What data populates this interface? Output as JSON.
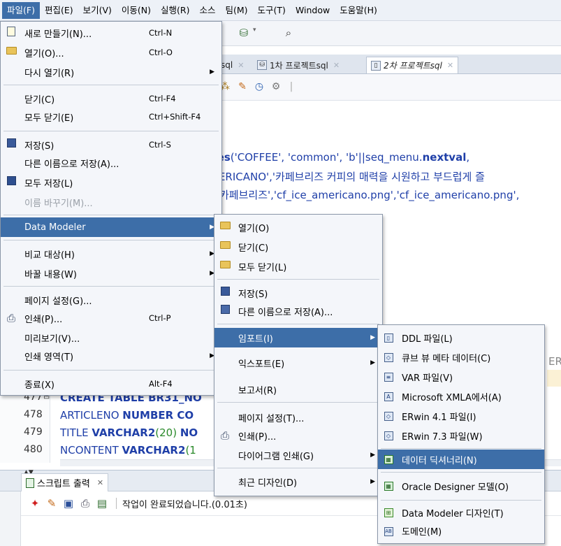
{
  "menubar": {
    "items": [
      "파일(F)",
      "편집(E)",
      "보기(V)",
      "이동(N)",
      "실행(R)",
      "소스",
      "팀(M)",
      "도구(T)",
      "Window",
      "도움말(H)"
    ]
  },
  "editor_tabs": [
    {
      "label": "sql"
    },
    {
      "label": "1차 프로젝트sql"
    },
    {
      "label": "2차 프로젝트sql"
    }
  ],
  "editor": {
    "code_top": [
      {
        "parts": [
          "ues",
          "('COFFEE', 'common', 'b'||seq_menu.",
          "nextval",
          ","
        ]
      },
      {
        "parts": [
          "MERICANO','카페브리즈 커피의 매력을 시원하고 부드럽게 즐"
        ]
      },
      {
        "parts": [
          "카페브리즈','cf_ice_americano.png','cf_ice_americano.png',"
        ]
      }
    ],
    "line_numbers": [
      "477",
      "478",
      "479",
      "480"
    ],
    "code_lines": [
      {
        "parts": [
          "CREATE TABLE ",
          "BR31_NO"
        ]
      },
      {
        "parts": [
          "ARTICLENO ",
          "NUMBER CO"
        ]
      },
      {
        "parts": [
          "TITLE ",
          "VARCHAR2",
          "(20) ",
          "NO"
        ]
      },
      {
        "parts": [
          "NCONTENT ",
          "VARCHAR2",
          "(1"
        ]
      }
    ],
    "right_clip": "ER",
    "collapse_marker": "⊟"
  },
  "output_panel": {
    "tab_label": "스크립트 출력",
    "status": "작업이 완료되었습니다.(0.01초)"
  },
  "file_menu": [
    {
      "type": "item",
      "label": "새로 만들기(N)...",
      "shortcut": "Ctrl-N",
      "icon": "new-icon"
    },
    {
      "type": "item",
      "label": "열기(O)...",
      "shortcut": "Ctrl-O",
      "icon": "folder-icon"
    },
    {
      "type": "item",
      "label": "다시 열기(R)",
      "shortcut": "",
      "submenu": true
    },
    {
      "type": "sep"
    },
    {
      "type": "item",
      "label": "닫기(C)",
      "shortcut": "Ctrl-F4"
    },
    {
      "type": "item",
      "label": "모두 닫기(E)",
      "shortcut": "Ctrl+Shift-F4"
    },
    {
      "type": "sep"
    },
    {
      "type": "item",
      "label": "저장(S)",
      "shortcut": "Ctrl-S",
      "icon": "save-icon"
    },
    {
      "type": "item",
      "label": "다른 이름으로 저장(A)...",
      "shortcut": ""
    },
    {
      "type": "item",
      "label": "모두 저장(L)",
      "shortcut": "",
      "icon": "save-all-icon"
    },
    {
      "type": "item",
      "label": "이름 바꾸기(M)...",
      "shortcut": "",
      "disabled": true
    },
    {
      "type": "sep"
    },
    {
      "type": "item",
      "label": "Data Modeler",
      "shortcut": "",
      "submenu": true,
      "highlighted": true
    },
    {
      "type": "sep"
    },
    {
      "type": "item",
      "label": "비교 대상(H)",
      "shortcut": "",
      "submenu": true
    },
    {
      "type": "item",
      "label": "바꿀 내용(W)",
      "shortcut": "",
      "submenu": true
    },
    {
      "type": "sep"
    },
    {
      "type": "item",
      "label": "페이지 설정(G)...",
      "shortcut": ""
    },
    {
      "type": "item",
      "label": "인쇄(P)...",
      "shortcut": "Ctrl-P",
      "icon": "print-icon"
    },
    {
      "type": "item",
      "label": "미리보기(V)...",
      "shortcut": ""
    },
    {
      "type": "item",
      "label": "인쇄 영역(T)",
      "shortcut": "",
      "submenu": true
    },
    {
      "type": "sep"
    },
    {
      "type": "item",
      "label": "종료(X)",
      "shortcut": "Alt-F4"
    }
  ],
  "data_modeler_menu": [
    {
      "type": "item",
      "label": "열기(O)",
      "icon": "folder-icon"
    },
    {
      "type": "item",
      "label": "닫기(C)",
      "icon": "folder-icon"
    },
    {
      "type": "item",
      "label": "모두 닫기(L)",
      "icon": "folder-icon"
    },
    {
      "type": "sep"
    },
    {
      "type": "item",
      "label": "저장(S)",
      "icon": "save-icon"
    },
    {
      "type": "item",
      "label": "다른 이름으로 저장(A)...",
      "icon": "save-as-icon"
    },
    {
      "type": "sep"
    },
    {
      "type": "item",
      "label": "임포트(I)",
      "submenu": true,
      "highlighted": true
    },
    {
      "type": "item",
      "label": "익스포트(E)",
      "submenu": true
    },
    {
      "type": "item",
      "label": "보고서(R)"
    },
    {
      "type": "sep"
    },
    {
      "type": "item",
      "label": "페이지 설정(T)..."
    },
    {
      "type": "item",
      "label": "인쇄(P)...",
      "icon": "print-icon"
    },
    {
      "type": "item",
      "label": "다이어그램 인쇄(G)",
      "submenu": true
    },
    {
      "type": "sep"
    },
    {
      "type": "item",
      "label": "최근 디자인(D)",
      "submenu": true
    }
  ],
  "import_menu": [
    {
      "type": "item",
      "label": "DDL 파일(L)",
      "icon": "ddl-icon"
    },
    {
      "type": "item",
      "label": "큐브 뷰 메타 데이터(C)",
      "icon": "cube-icon"
    },
    {
      "type": "item",
      "label": "VAR 파일(V)",
      "icon": "var-icon"
    },
    {
      "type": "item",
      "label": "Microsoft XMLA에서(A)",
      "icon": "xmla-icon"
    },
    {
      "type": "item",
      "label": "ERwin 4.1 파일(I)",
      "icon": "erwin-icon"
    },
    {
      "type": "item",
      "label": "ERwin 7.3 파일(W)",
      "icon": "erwin-icon"
    },
    {
      "type": "sep"
    },
    {
      "type": "item",
      "label": "데이터 딕셔너리(N)",
      "icon": "dictionary-icon",
      "highlighted": true
    },
    {
      "type": "sep"
    },
    {
      "type": "item",
      "label": "Oracle Designer 모델(O)",
      "icon": "designer-icon"
    },
    {
      "type": "sep"
    },
    {
      "type": "item",
      "label": "Data Modeler 디자인(T)",
      "icon": "modeler-design-icon"
    },
    {
      "type": "item",
      "label": "도메인(M)",
      "icon": "domain-icon"
    }
  ]
}
